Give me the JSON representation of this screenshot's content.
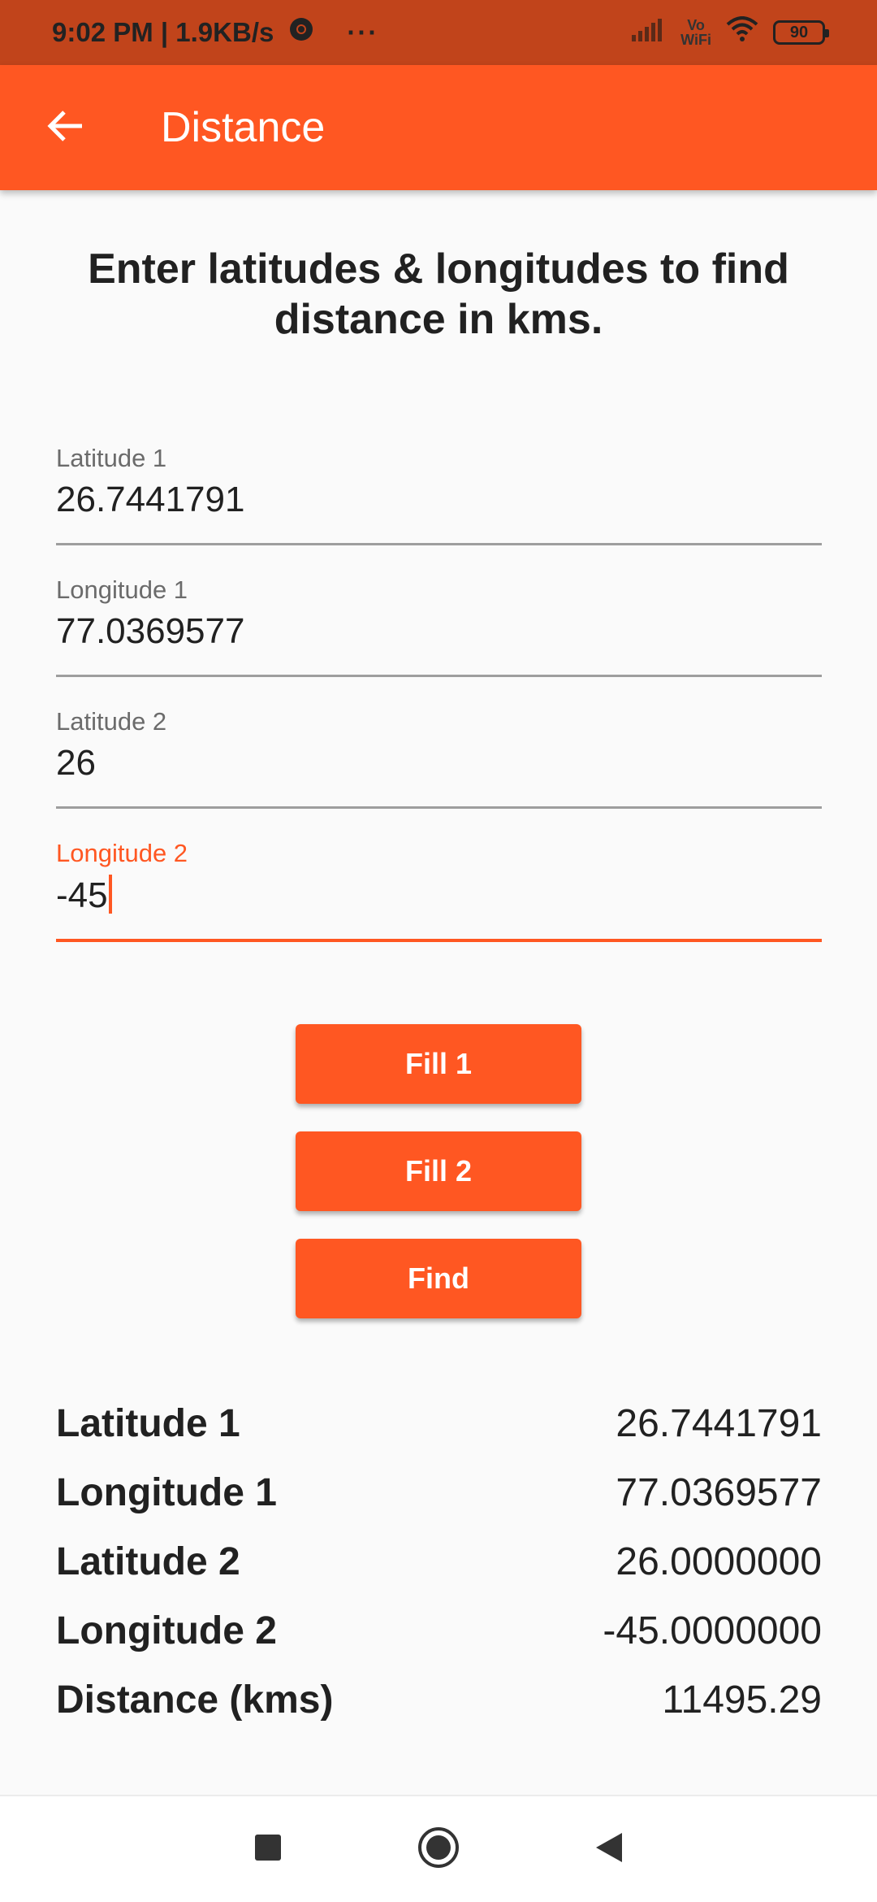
{
  "status_bar": {
    "time": "9:02 PM | 1.9KB/s",
    "more": "···",
    "vowifi_top": "Vo",
    "vowifi_bottom": "WiFi",
    "battery": "90"
  },
  "app_bar": {
    "title": "Distance",
    "back_icon": "arrow-back-icon"
  },
  "heading": "Enter latitudes & longitudes to find distance in kms.",
  "fields": [
    {
      "label": "Latitude 1",
      "value": "26.7441791"
    },
    {
      "label": "Longitude 1",
      "value": "77.0369577"
    },
    {
      "label": "Latitude 2",
      "value": "26"
    },
    {
      "label": "Longitude 2",
      "value": "-45"
    }
  ],
  "buttons": {
    "fill1": "Fill 1",
    "fill2": "Fill 2",
    "find": "Find"
  },
  "results": [
    {
      "label": "Latitude 1",
      "value": "26.7441791"
    },
    {
      "label": "Longitude 1",
      "value": "77.0369577"
    },
    {
      "label": "Latitude 2",
      "value": "26.0000000"
    },
    {
      "label": "Longitude 2",
      "value": "-45.0000000"
    },
    {
      "label": "Distance (kms)",
      "value": "11495.29"
    }
  ],
  "colors": {
    "accent": "#ff5722",
    "status_bar": "#c1441b",
    "background": "#fafafa"
  }
}
